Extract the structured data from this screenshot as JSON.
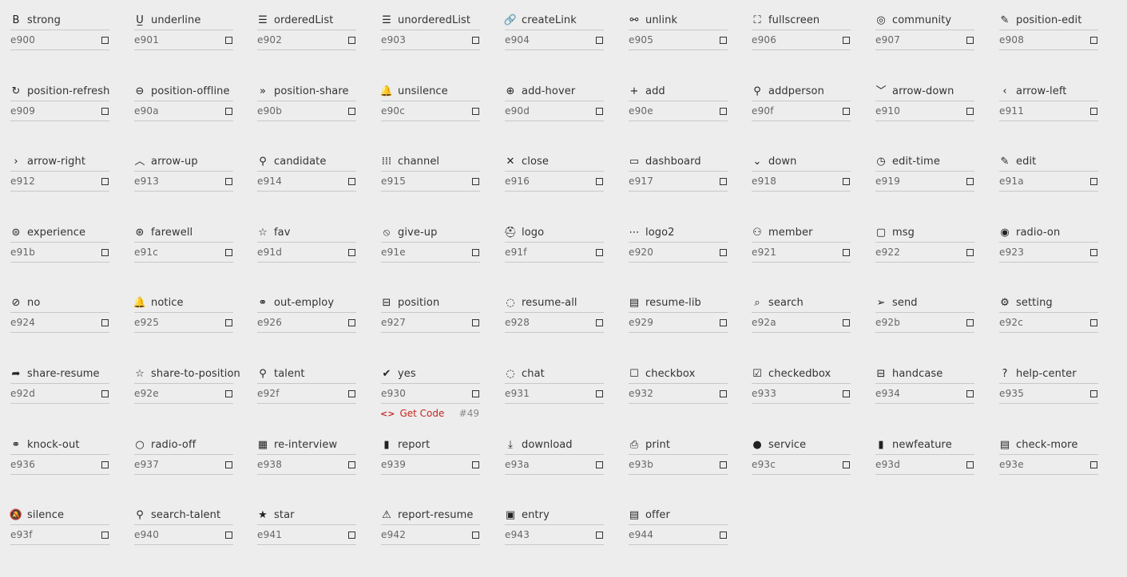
{
  "glyphs": [
    {
      "name": "strong",
      "code": "e900",
      "icon": "bold-icon",
      "glyph": "B"
    },
    {
      "name": "underline",
      "code": "e901",
      "icon": "underline-icon",
      "glyph": "U̲"
    },
    {
      "name": "orderedList",
      "code": "e902",
      "icon": "ordered-list-icon",
      "glyph": "☰"
    },
    {
      "name": "unorderedList",
      "code": "e903",
      "icon": "unordered-list-icon",
      "glyph": "☰"
    },
    {
      "name": "createLink",
      "code": "e904",
      "icon": "link-icon",
      "glyph": "🔗"
    },
    {
      "name": "unlink",
      "code": "e905",
      "icon": "unlink-icon",
      "glyph": "⚯"
    },
    {
      "name": "fullscreen",
      "code": "e906",
      "icon": "fullscreen-icon",
      "glyph": "⛶"
    },
    {
      "name": "community",
      "code": "e907",
      "icon": "community-icon",
      "glyph": "◎"
    },
    {
      "name": "position-edit",
      "code": "e908",
      "icon": "pencil-icon",
      "glyph": "✎"
    },
    {
      "name": "position-refresh",
      "code": "e909",
      "icon": "refresh-icon",
      "glyph": "↻"
    },
    {
      "name": "position-offline",
      "code": "e90a",
      "icon": "offline-icon",
      "glyph": "⊖"
    },
    {
      "name": "position-share",
      "code": "e90b",
      "icon": "double-chevron-right-icon",
      "glyph": "»"
    },
    {
      "name": "unsilence",
      "code": "e90c",
      "icon": "bell-icon",
      "glyph": "🔔"
    },
    {
      "name": "add-hover",
      "code": "e90d",
      "icon": "add-circle-filled-icon",
      "glyph": "⊕"
    },
    {
      "name": "add",
      "code": "e90e",
      "icon": "plus-icon",
      "glyph": "+"
    },
    {
      "name": "addperson",
      "code": "e90f",
      "icon": "add-person-icon",
      "glyph": "⚲"
    },
    {
      "name": "arrow-down",
      "code": "e910",
      "icon": "chevron-down-icon",
      "glyph": "﹀"
    },
    {
      "name": "arrow-left",
      "code": "e911",
      "icon": "chevron-left-icon",
      "glyph": "‹"
    },
    {
      "name": "arrow-right",
      "code": "e912",
      "icon": "chevron-right-icon",
      "glyph": "›"
    },
    {
      "name": "arrow-up",
      "code": "e913",
      "icon": "chevron-up-icon",
      "glyph": "︿"
    },
    {
      "name": "candidate",
      "code": "e914",
      "icon": "person-icon",
      "glyph": "⚲"
    },
    {
      "name": "channel",
      "code": "e915",
      "icon": "grid-dots-icon",
      "glyph": "⁞⁞⁞"
    },
    {
      "name": "close",
      "code": "e916",
      "icon": "close-icon",
      "glyph": "✕"
    },
    {
      "name": "dashboard",
      "code": "e917",
      "icon": "monitor-icon",
      "glyph": "▭"
    },
    {
      "name": "down",
      "code": "e918",
      "icon": "small-chevron-down-icon",
      "glyph": "⌄"
    },
    {
      "name": "edit-time",
      "code": "e919",
      "icon": "clock-icon",
      "glyph": "◷"
    },
    {
      "name": "edit",
      "code": "e91a",
      "icon": "edit-icon",
      "glyph": "✎"
    },
    {
      "name": "experience",
      "code": "e91b",
      "icon": "experience-icon",
      "glyph": "⊜"
    },
    {
      "name": "farewell",
      "code": "e91c",
      "icon": "farewell-icon",
      "glyph": "⊛"
    },
    {
      "name": "fav",
      "code": "e91d",
      "icon": "star-outline-icon",
      "glyph": "☆"
    },
    {
      "name": "give-up",
      "code": "e91e",
      "icon": "ban-icon",
      "glyph": "⦸"
    },
    {
      "name": "logo",
      "code": "e91f",
      "icon": "logo-icon",
      "glyph": "⛑"
    },
    {
      "name": "logo2",
      "code": "e920",
      "icon": "logo2-icon",
      "glyph": "⋯"
    },
    {
      "name": "member",
      "code": "e921",
      "icon": "members-icon",
      "glyph": "⚇"
    },
    {
      "name": "msg",
      "code": "e922",
      "icon": "message-icon",
      "glyph": "▢"
    },
    {
      "name": "radio-on",
      "code": "e923",
      "icon": "radio-on-icon",
      "glyph": "◉"
    },
    {
      "name": "no",
      "code": "e924",
      "icon": "no-icon",
      "glyph": "⊘"
    },
    {
      "name": "notice",
      "code": "e925",
      "icon": "notice-bell-icon",
      "glyph": "🔔"
    },
    {
      "name": "out-employ",
      "code": "e926",
      "icon": "out-employ-icon",
      "glyph": "⚭"
    },
    {
      "name": "position",
      "code": "e927",
      "icon": "briefcase-icon",
      "glyph": "⊟"
    },
    {
      "name": "resume-all",
      "code": "e928",
      "icon": "resume-all-icon",
      "glyph": "◌"
    },
    {
      "name": "resume-lib",
      "code": "e929",
      "icon": "document-icon",
      "glyph": "▤"
    },
    {
      "name": "search",
      "code": "e92a",
      "icon": "search-icon",
      "glyph": "⌕"
    },
    {
      "name": "send",
      "code": "e92b",
      "icon": "send-icon",
      "glyph": "➢"
    },
    {
      "name": "setting",
      "code": "e92c",
      "icon": "gear-icon",
      "glyph": "⚙"
    },
    {
      "name": "share-resume",
      "code": "e92d",
      "icon": "share-arrow-icon",
      "glyph": "➦"
    },
    {
      "name": "share-to-position",
      "code": "e92e",
      "icon": "share-star-icon",
      "glyph": "☆"
    },
    {
      "name": "talent",
      "code": "e92f",
      "icon": "talent-icon",
      "glyph": "⚲"
    },
    {
      "name": "yes",
      "code": "e930",
      "icon": "check-icon",
      "glyph": "✔"
    },
    {
      "name": "chat",
      "code": "e931",
      "icon": "chat-bubble-icon",
      "glyph": "◌"
    },
    {
      "name": "checkbox",
      "code": "e932",
      "icon": "checkbox-icon",
      "glyph": "☐"
    },
    {
      "name": "checkedbox",
      "code": "e933",
      "icon": "checkedbox-icon",
      "glyph": "☑"
    },
    {
      "name": "handcase",
      "code": "e934",
      "icon": "handcase-icon",
      "glyph": "⊟"
    },
    {
      "name": "help-center",
      "code": "e935",
      "icon": "help-icon",
      "glyph": "?"
    },
    {
      "name": "knock-out",
      "code": "e936",
      "icon": "knock-out-icon",
      "glyph": "⚭"
    },
    {
      "name": "radio-off",
      "code": "e937",
      "icon": "radio-off-icon",
      "glyph": "○"
    },
    {
      "name": "re-interview",
      "code": "e938",
      "icon": "calendar-icon",
      "glyph": "▦"
    },
    {
      "name": "report",
      "code": "e939",
      "icon": "bar-chart-icon",
      "glyph": "▮"
    },
    {
      "name": "download",
      "code": "e93a",
      "icon": "download-icon",
      "glyph": "⤓"
    },
    {
      "name": "print",
      "code": "e93b",
      "icon": "printer-icon",
      "glyph": "⎙"
    },
    {
      "name": "service",
      "code": "e93c",
      "icon": "service-icon",
      "glyph": "●"
    },
    {
      "name": "newfeature",
      "code": "e93d",
      "icon": "bookmark-icon",
      "glyph": "▮"
    },
    {
      "name": "check-more",
      "code": "e93e",
      "icon": "check-more-icon",
      "glyph": "▤"
    },
    {
      "name": "silence",
      "code": "e93f",
      "icon": "bell-off-icon",
      "glyph": "🔕"
    },
    {
      "name": "search-talent",
      "code": "e940",
      "icon": "search-person-icon",
      "glyph": "⚲"
    },
    {
      "name": "star",
      "code": "e941",
      "icon": "star-filled-icon",
      "glyph": "★"
    },
    {
      "name": "report-resume",
      "code": "e942",
      "icon": "warning-icon",
      "glyph": "⚠"
    },
    {
      "name": "entry",
      "code": "e943",
      "icon": "id-card-icon",
      "glyph": "▣"
    },
    {
      "name": "offer",
      "code": "e944",
      "icon": "offer-doc-icon",
      "glyph": "▤"
    }
  ],
  "get_code": {
    "label": "Get Code",
    "arrows": "<>",
    "number": "#49"
  },
  "colors": {
    "accent": "#c7271f",
    "background": "#ededed",
    "text": "#333333"
  }
}
